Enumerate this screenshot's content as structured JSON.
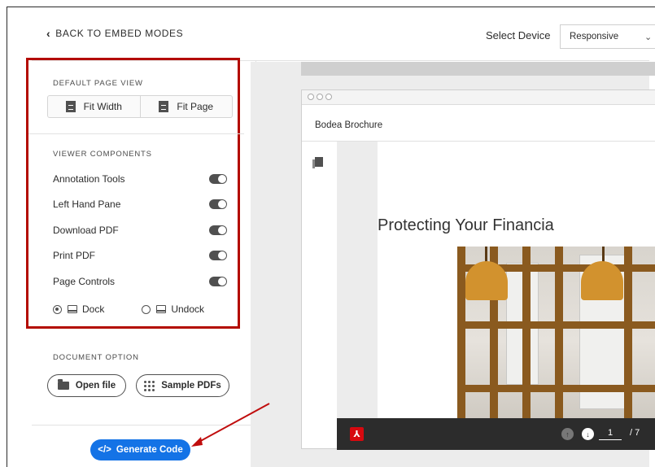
{
  "nav": {
    "back_label": "BACK TO EMBED MODES"
  },
  "page_view": {
    "section_label": "DEFAULT PAGE VIEW",
    "fit_width_label": "Fit Width",
    "fit_page_label": "Fit Page"
  },
  "components": {
    "section_label": "VIEWER COMPONENTS",
    "items": [
      {
        "label": "Annotation Tools",
        "enabled": true
      },
      {
        "label": "Left Hand Pane",
        "enabled": true
      },
      {
        "label": "Download PDF",
        "enabled": true
      },
      {
        "label": "Print PDF",
        "enabled": true
      },
      {
        "label": "Page Controls",
        "enabled": true
      }
    ],
    "dock_label": "Dock",
    "undock_label": "Undock",
    "dock_selected": "Dock"
  },
  "document": {
    "section_label": "DOCUMENT OPTION",
    "open_file_label": "Open file",
    "sample_pdfs_label": "Sample PDFs"
  },
  "generate": {
    "label": "Generate Code",
    "icon_text": "</>"
  },
  "device": {
    "label": "Select Device",
    "selected": "Responsive",
    "caret": "⌄"
  },
  "viewer": {
    "doc_title": "Bodea Brochure",
    "heading": "Protecting Your Financia",
    "current_page": "1",
    "total_pages": "/ 7",
    "up_glyph": "↑",
    "down_glyph": "↓"
  },
  "colors": {
    "highlight_border": "#b30b00",
    "primary_button": "#1473e6",
    "toolbar": "#2c2c2c",
    "pdf_red": "#d7090f"
  }
}
